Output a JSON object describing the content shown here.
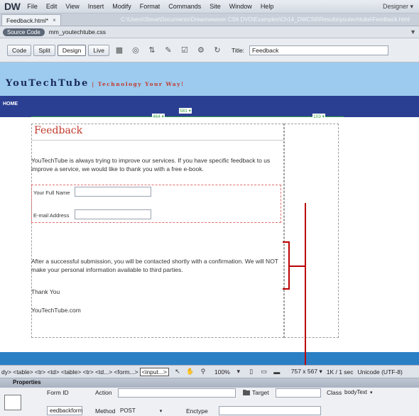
{
  "app": {
    "logo": "DW",
    "workspace": "Designer ▾"
  },
  "menu": [
    "File",
    "Edit",
    "View",
    "Insert",
    "Modify",
    "Format",
    "Commands",
    "Site",
    "Window",
    "Help"
  ],
  "doc_tab": {
    "label": "Feedback.html*",
    "close": "×",
    "path": "C:\\Users\\Steve\\Documents\\Dreamweaver CS6 DVD\\Examples\\Ch14_DWCS6\\Results\\youtechtube\\Feedback.html"
  },
  "related": {
    "source_code": "Source Code",
    "css_file": "mm_youtechtube.css"
  },
  "toolbar": {
    "code": "Code",
    "split": "Split",
    "design": "Design",
    "live": "Live",
    "title_label": "Title:",
    "title_value": "Feedback"
  },
  "design": {
    "site_title": "YouTechTube",
    "tagline": "| Technology Your Way!",
    "nav_home": "HOME",
    "ruler_total": "581 ▾",
    "ruler_left": "464 ▾",
    "ruler_right": "103 ▾",
    "heading": "Feedback",
    "intro": "YouTechTube is always trying to improve our services. If you have specific feedback to us improve a service, we would like to thank you with a free e-book.",
    "name_label": "Your Full Name",
    "email_label": "E-mail Address",
    "after": "After a successful submission, you will be contacted shortly with a confirmation. We will NOT make your personal information available to third parties.",
    "thanks": "Thank You",
    "signature": "YouTechTube.com"
  },
  "tagbar": {
    "path": "dy> <table> <tr> <td> <table> <tr> <td...> <form...>",
    "selected": "<input...>",
    "zoom": "100%",
    "dims": "757 x 567 ▾",
    "download": "1K / 1 sec",
    "encoding": "Unicode (UTF-8)"
  },
  "properties": {
    "header": "Properties",
    "form_id_label": "Form ID",
    "form_id": "eedbackform",
    "action_label": "Action",
    "method_label": "Method",
    "method": "POST",
    "target_label": "Target",
    "enctype_label": "Enctype",
    "class_label": "Class",
    "class_value": "bodyText"
  }
}
